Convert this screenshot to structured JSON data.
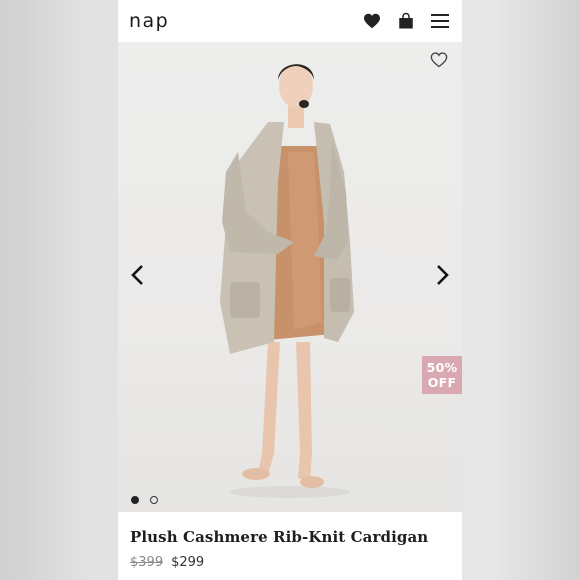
{
  "header": {
    "logo": "nap",
    "icons": [
      "heart-icon",
      "shopping-bag-icon",
      "hamburger-menu-icon"
    ]
  },
  "gallery": {
    "badge": {
      "line1": "50%",
      "line2": "OFF"
    },
    "slides_total": 2,
    "active_slide": 1,
    "icons": [
      "wishlist-heart-outline-icon",
      "chevron-left-icon",
      "chevron-right-icon"
    ]
  },
  "product": {
    "title": "Plush Cashmere Rib-Knit Cardigan",
    "original_price": "$399",
    "sale_price": "$299"
  },
  "colors": {
    "badge": "#d9a8b0",
    "text": "#1e1e1e",
    "strike": "#8a8a8a"
  }
}
